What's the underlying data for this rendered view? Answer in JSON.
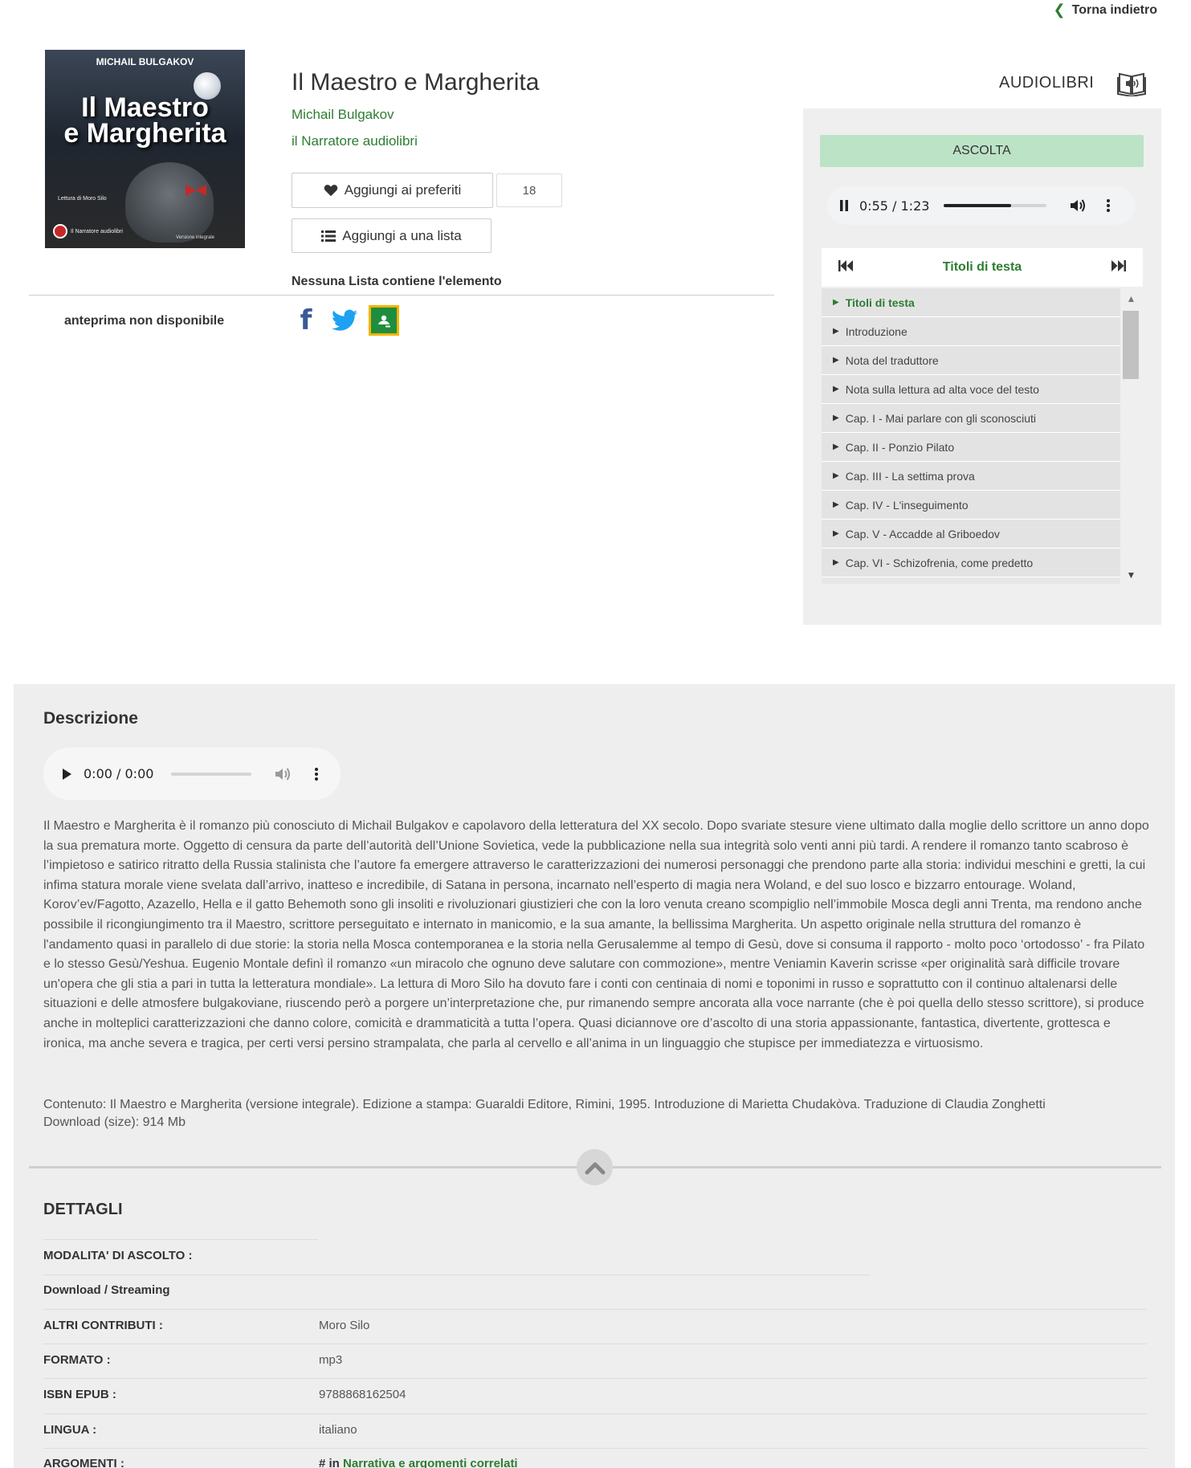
{
  "nav": {
    "back_label": "Torna indietro"
  },
  "cover": {
    "author": "MICHAIL BULGAKOV",
    "title_line1": "Il Maestro",
    "title_line2": "e Margherita",
    "reader": "Lettura di Moro Silo",
    "publisher": "Il Narratore audiolibri",
    "edition": "Versione integrale"
  },
  "book": {
    "title": "Il Maestro e Margherita",
    "author": "Michail Bulgakov",
    "publisher": "il Narratore audiolibri",
    "favorites_label": "Aggiungi ai preferiti",
    "favorites_count": "18",
    "list_label": "Aggiungi a una lista",
    "no_list": "Nessuna Lista contiene l'elemento",
    "preview_unavailable": "anteprima non disponibile"
  },
  "player": {
    "category": "AUDIOLIBRI",
    "ascolta_label": "ASCOLTA",
    "current_time": "0:55",
    "total_time": "1:23",
    "progress": 0.65,
    "chapters_title": "Titoli di testa",
    "chapters": [
      "Titoli di testa",
      "Introduzione",
      "Nota del traduttore",
      "Nota sulla lettura ad alta voce del testo",
      "Cap. I - Mai parlare con gli sconosciuti",
      "Cap. II - Ponzio Pilato",
      "Cap. III - La settima prova",
      "Cap. IV - L'inseguimento",
      "Cap. V - Accadde al Griboedov",
      "Cap. VI - Schizofrenia, come predetto"
    ]
  },
  "description": {
    "heading": "Descrizione",
    "audio_time": "0:00 / 0:00",
    "text": "Il Maestro e Margherita è il romanzo più conosciuto di Michail Bulgakov e capolavoro della letteratura del XX secolo. Dopo svariate stesure viene ultimato dalla moglie dello scrittore un anno dopo la sua prematura morte. Oggetto di censura da parte dell’autorità dell’Unione Sovietica, vede la pubblicazione nella sua integrità solo venti anni più tardi. A rendere il romanzo tanto scabroso è l’impietoso e satirico ritratto della Russia stalinista che l’autore fa emergere attraverso le caratterizzazioni dei numerosi personaggi che prendono parte alla storia: individui meschini e gretti, la cui infima statura morale viene svelata dall’arrivo, inatteso e incredibile, di Satana in persona, incarnato nell’esperto di magia nera Woland, e del suo losco e bizzarro entourage. Woland, Korov’ev/Fagotto, Azazello, Hella e il gatto Behemoth sono gli insoliti e rivoluzionari giustizieri che con la loro venuta creano scompiglio nell’immobile Mosca degli anni Trenta, ma rendono anche possibile il ricongiungimento tra il Maestro, scrittore perseguitato e internato in manicomio, e la sua amante, la bellissima Margherita. Un aspetto originale nella struttura del romanzo è l'andamento quasi in parallelo di due storie: la storia nella Mosca contemporanea e la storia nella Gerusalemme al tempo di Gesù, dove si consuma il rapporto - molto poco ‘ortodosso’ - fra Pilato e lo stesso Gesù/Yeshua. Eugenio Montale definì il romanzo «un miracolo che ognuno deve salutare con commozione», mentre Veniamin Kaverin scrisse «per originalità sarà difficile trovare un'opera che gli stia a pari in tutta la letteratura mondiale». La lettura di Moro Silo ha dovuto fare i conti con centinaia di nomi e toponimi in russo e soprattutto con il continuo altalenarsi delle situazioni e delle atmosfere bulgakoviane, riuscendo però a porgere un’interpretazione che, pur rimanendo sempre ancorata alla voce narrante (che è poi quella dello stesso scrittore), si produce anche in molteplici caratterizzazioni che danno colore, comicità e drammaticità a tutta l’opera. Quasi diciannove ore d’ascolto di una storia appassionante, fantastica, divertente, grottesca e ironica, ma anche severa e tragica, per certi versi persino strampalata, che parla al cervello e all’anima in un linguaggio che stupisce per immediatezza e virtuosismo.",
    "content": "Contenuto: Il Maestro e Margherita (versione integrale). Edizione a stampa: Guaraldi Editore, Rimini, 1995. Introduzione di Marietta Chudakòva. Traduzione di Claudia Zonghetti",
    "download": "Download (size):  914 Mb"
  },
  "details": {
    "heading": "DETTAGLI",
    "listening_mode_label": "MODALITA' DI ASCOLTO :",
    "listening_mode_value": "Download / Streaming",
    "other_contrib_label": "ALTRI CONTRIBUTI :",
    "other_contrib_value": "Moro Silo",
    "format_label": "FORMATO :",
    "format_value": "mp3",
    "isbn_label": "ISBN EPUB :",
    "isbn_value": "9788868162504",
    "language_label": "LINGUA :",
    "language_value": "italiano",
    "topics_label": "ARGOMENTI :",
    "topics_prefix": "# in",
    "topics_link": "Narrativa e argomenti correlati"
  },
  "colors": {
    "accent": "#2e7d32",
    "ascolta_bg": "#bde3c7",
    "panel_bg": "#efefef"
  }
}
